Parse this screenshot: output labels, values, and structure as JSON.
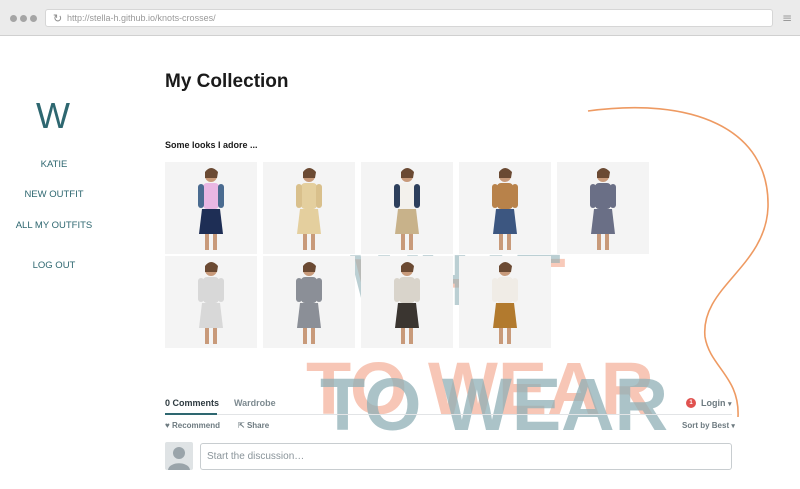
{
  "browser": {
    "url": "http://stella-h.github.io/knots-crosses/",
    "reload_icon": "reload-icon",
    "menu_icon": "hamburger-menu-icon"
  },
  "sidebar": {
    "logo": "W",
    "items": [
      {
        "label": "KATIE"
      },
      {
        "label": "NEW OUTFIT"
      },
      {
        "label": "ALL MY OUTFITS"
      },
      {
        "label": "LOG OUT"
      }
    ]
  },
  "main": {
    "title": "My Collection",
    "subtitle": "Some looks I adore ...",
    "looks": [
      {
        "top": "#e9b7e3",
        "bottom": "#1e2e55",
        "jacket": "#4a6b90"
      },
      {
        "top": "#e4cf9e",
        "bottom": "#e4cf9e",
        "jacket": "#d9c08c"
      },
      {
        "top": "#f3f1ec",
        "bottom": "#c8b28a",
        "jacket": "#2d3f5c"
      },
      {
        "top": "#b8824a",
        "bottom": "#3c5680",
        "jacket": "#b8824a"
      },
      {
        "top": "#6a6f86",
        "bottom": "#6a6f86",
        "jacket": "#6a6f86"
      },
      {
        "top": "#d8d8d8",
        "bottom": "#d8d8d8",
        "jacket": "#d8d8d8"
      },
      {
        "top": "#8b8f97",
        "bottom": "#8b8f97",
        "jacket": "#8b8f97"
      },
      {
        "top": "#d9d4cb",
        "bottom": "#3a3530",
        "jacket": "#d9d4cb"
      },
      {
        "top": "#f0ece6",
        "bottom": "#b27a2e",
        "jacket": "#f0ece6"
      }
    ]
  },
  "decoration": {
    "banner_line1": "WHAT",
    "banner_line2": "TO WEAR",
    "salmon": "#f6b9a4",
    "teal": "#8fb0b6",
    "curve_color": "#ee9a62"
  },
  "comments": {
    "tabs": [
      {
        "label": "0 Comments"
      },
      {
        "label": "Wardrobe"
      }
    ],
    "badge_count": "1",
    "login_label": "Login",
    "recommend_label": "Recommend",
    "share_label": "Share",
    "sort_label": "Sort by Best",
    "placeholder": "Start the discussion…"
  }
}
